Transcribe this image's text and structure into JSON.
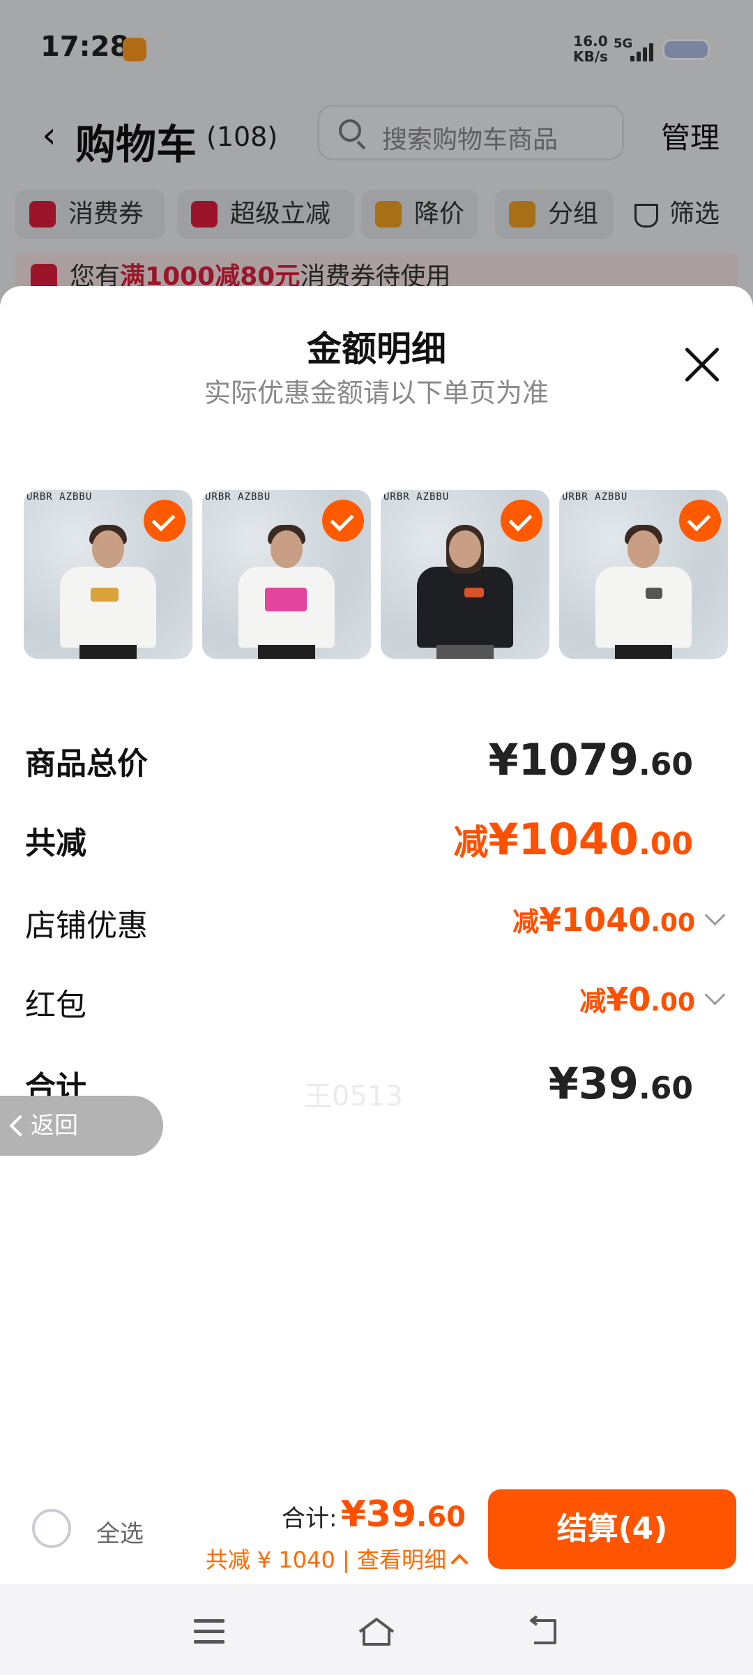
{
  "status_bar": {
    "time": "17:28",
    "net_speed": "16.0",
    "net_unit": "KB/s",
    "signal": "5G"
  },
  "header": {
    "back_icon": "chevron-left-icon",
    "title": "购物车",
    "count": "(108)",
    "search_placeholder": "搜索购物车商品",
    "manage": "管理"
  },
  "filters": [
    {
      "label": "消费券",
      "icon": "coupon-icon",
      "color": "#e01e3c"
    },
    {
      "label": "超级立减",
      "icon": "arrow-down-icon",
      "color": "#e01e3c"
    },
    {
      "label": "降价",
      "icon": "price-drop-icon",
      "color": "#f0a020"
    },
    {
      "label": "分组",
      "icon": "folder-icon",
      "color": "#f0a020"
    },
    {
      "label": "筛选",
      "icon": "filter-icon",
      "color": "#333333"
    }
  ],
  "notice": {
    "prefix": "您有",
    "highlight": "满1000减80元",
    "suffix": "消费券待使用"
  },
  "sheet": {
    "title": "金额明细",
    "subtitle": "实际优惠金额请以下单页为准",
    "products": [
      {
        "brand": "URBR AZBBU",
        "shirt": "#f4f4f2",
        "print": "#d9a33a",
        "selected": true
      },
      {
        "brand": "URBR AZBBU",
        "shirt": "#f4f4f2",
        "print": "#e2459b",
        "selected": true
      },
      {
        "brand": "URBR AZBBU",
        "shirt": "#1d1f22",
        "print": "#d9532a",
        "selected": true
      },
      {
        "brand": "URBR AZBBU",
        "shirt": "#f4f4f2",
        "print": "#555555",
        "selected": true
      }
    ],
    "rows": {
      "total_price": {
        "label": "商品总价",
        "prefix": "",
        "int": "¥1079",
        "dec": ".60"
      },
      "total_reduce": {
        "label": "共减",
        "prefix": "减",
        "int": "¥1040",
        "dec": ".00"
      },
      "shop_discount": {
        "label": "店铺优惠",
        "prefix": "减",
        "int": "¥1040",
        "dec": ".00"
      },
      "red_packet": {
        "label": "红包",
        "prefix": "减",
        "int": "¥0",
        "dec": ".00"
      },
      "sum": {
        "label": "合计",
        "prefix": "",
        "int": "¥39",
        "dec": ".60"
      }
    },
    "watermark": "王0513",
    "back_button": "返回"
  },
  "bottom_bar": {
    "select_all": "全选",
    "total_label": "合计:",
    "total_int": "¥39",
    "total_dec": ".60",
    "reduce_text": "共减 ¥ 1040 | 查看明细",
    "checkout": "结算(4)"
  },
  "colors": {
    "accent": "#ff5500",
    "price_orange": "#ff5000",
    "coupon_red": "#e01e3c"
  }
}
